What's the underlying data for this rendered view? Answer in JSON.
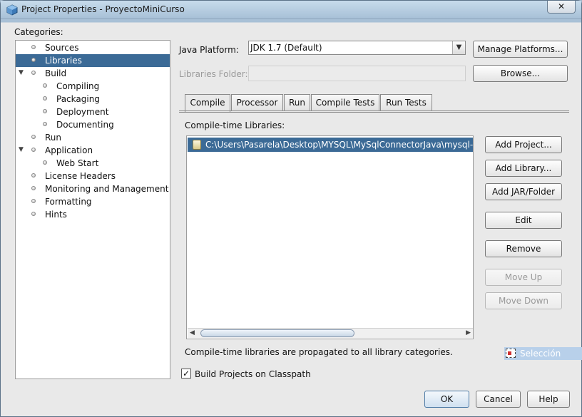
{
  "window": {
    "title": "Project Properties - ProyectoMiniCurso",
    "close_label": "✕"
  },
  "categories": {
    "label": "Categories:",
    "items": [
      {
        "label": "Sources",
        "selected": false
      },
      {
        "label": "Libraries",
        "selected": true
      },
      {
        "label": "Build",
        "selected": false,
        "expanded": true
      },
      {
        "label": "Compiling",
        "selected": false
      },
      {
        "label": "Packaging",
        "selected": false
      },
      {
        "label": "Deployment",
        "selected": false
      },
      {
        "label": "Documenting",
        "selected": false
      },
      {
        "label": "Run",
        "selected": false
      },
      {
        "label": "Application",
        "selected": false,
        "expanded": true
      },
      {
        "label": "Web Start",
        "selected": false
      },
      {
        "label": "License Headers",
        "selected": false
      },
      {
        "label": "Monitoring and Management",
        "selected": false
      },
      {
        "label": "Formatting",
        "selected": false
      },
      {
        "label": "Hints",
        "selected": false
      }
    ]
  },
  "platform": {
    "label": "Java Platform:",
    "value": "JDK 1.7 (Default)",
    "manage_button": "Manage Platforms..."
  },
  "libraries_folder": {
    "label": "Libraries Folder:",
    "value": "",
    "browse_button": "Browse..."
  },
  "tabs": [
    {
      "label": "Compile",
      "active": true
    },
    {
      "label": "Processor",
      "active": false
    },
    {
      "label": "Run",
      "active": false
    },
    {
      "label": "Compile Tests",
      "active": false
    },
    {
      "label": "Run Tests",
      "active": false
    }
  ],
  "compile_libraries": {
    "label": "Compile-time Libraries:",
    "items": [
      "C:\\Users\\Pasarela\\Desktop\\MYSQL\\MySqlConnectorJava\\mysql-conn"
    ],
    "note": "Compile-time libraries are propagated to all library categories."
  },
  "side_buttons": {
    "add_project": "Add Project...",
    "add_library": "Add Library...",
    "add_jar": "Add JAR/Folder",
    "edit": "Edit",
    "remove": "Remove",
    "move_up": "Move Up",
    "move_down": "Move Down"
  },
  "build_on_classpath": {
    "label": "Build Projects on Classpath",
    "checked": true,
    "check_glyph": "✓"
  },
  "overlay": {
    "seleccion": "Selección"
  },
  "dialog_buttons": {
    "ok": "OK",
    "cancel": "Cancel",
    "help": "Help"
  },
  "colors": {
    "selection": "#3b6a96",
    "title_bar": "#b9d0e4",
    "dialog_bg": "#e9e9e9"
  }
}
